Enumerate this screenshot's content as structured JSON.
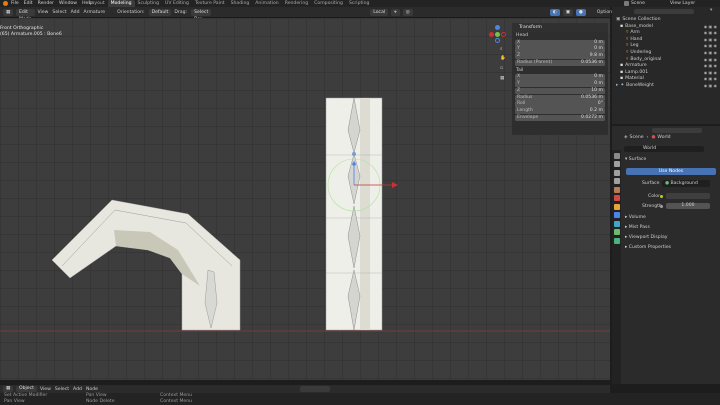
{
  "topbar": {
    "menu": [
      "File",
      "Edit",
      "Render",
      "Window",
      "Help"
    ],
    "workspaces": [
      "Layout",
      "Modeling",
      "Sculpting",
      "UV Editing",
      "Texture Paint",
      "Shading",
      "Animation",
      "Rendering",
      "Compositing",
      "Scripting"
    ],
    "active_workspace": "Modeling",
    "scene_label": "Scene",
    "view_layer_label": "View Layer"
  },
  "viewport_header": {
    "mode": "Edit Mode",
    "menus": [
      "View",
      "Select",
      "Add",
      "Armature"
    ],
    "orientation_label": "Orientation:",
    "orientation_value": "Default",
    "drag_label": "Drag:",
    "drag_value": "Select Box",
    "transform_space": "Local",
    "options_label": "Options"
  },
  "viewport_info": {
    "line1": "Front Orthographic",
    "line2": "(65) Armature.005 : Bone6"
  },
  "npanel": {
    "title": "Transform",
    "head_label": "Head",
    "head": [
      {
        "l": "X",
        "v": "0 m"
      },
      {
        "l": "Y",
        "v": "0 m"
      },
      {
        "l": "Z",
        "v": "9.8 m"
      }
    ],
    "radius_head": {
      "l": "Radius (Parent)",
      "v": "0.0536 m"
    },
    "tail_label": "Tail",
    "tail": [
      {
        "l": "X",
        "v": "0 m"
      },
      {
        "l": "Y",
        "v": "0 m"
      },
      {
        "l": "Z",
        "v": "10 m"
      }
    ],
    "extra": [
      {
        "l": "Radius",
        "v": "0.0536 m"
      },
      {
        "l": "Roll",
        "v": "0°"
      },
      {
        "l": "Length",
        "v": "0.2 m"
      },
      {
        "l": "Envelope",
        "v": "0.0272 m"
      }
    ]
  },
  "outliner": {
    "items": [
      {
        "label": "Scene Collection",
        "indent": 0
      },
      {
        "label": "Base_model",
        "indent": 1
      },
      {
        "label": "Arm",
        "indent": 2
      },
      {
        "label": "Hand",
        "indent": 2
      },
      {
        "label": "Leg",
        "indent": 2
      },
      {
        "label": "Underleg",
        "indent": 2
      },
      {
        "label": "Body_original",
        "indent": 2
      },
      {
        "label": "Armature",
        "indent": 1
      },
      {
        "label": "Lamp.001",
        "indent": 1
      },
      {
        "label": "Material",
        "indent": 1
      },
      {
        "label": "BoneWeight",
        "indent": 1
      }
    ]
  },
  "properties": {
    "breadcrumb_scene": "Scene",
    "breadcrumb_world": "World",
    "world_name": "World",
    "surface_label": "Surface",
    "use_nodes_label": "Use Nodes",
    "surface_field_label": "Surface",
    "surface_value": "Background",
    "color_label": "Color",
    "strength_label": "Strength",
    "strength_value": "1.000",
    "sections": [
      "Volume",
      "Mist Pass",
      "Viewport Display",
      "Custom Properties"
    ]
  },
  "timeline": {
    "menus": [
      "Object",
      "View",
      "Select",
      "Add",
      "Node"
    ]
  },
  "statusbar": {
    "col1": [
      "Set Active Modifier",
      "Pan View",
      "Set Active Modifier"
    ],
    "col2": [
      "Pan View",
      "Node Delete"
    ],
    "col3": [
      "Context Menu",
      "Context Menu"
    ]
  },
  "colors": {
    "accent": "#4772b3",
    "active_tab": "#3b3b3b",
    "x_axis": "#c83232",
    "y_axis": "#64a632"
  }
}
